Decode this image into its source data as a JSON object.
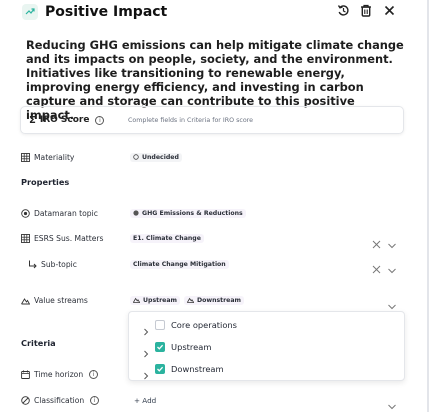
{
  "header": {
    "title": "Positive Impact",
    "icons": [
      "trend-icon",
      "history-icon",
      "trash-icon",
      "close-icon"
    ]
  },
  "description": "Reducing GHG emissions can help mitigate climate change and its impacts on people, society, and the environment. Initiatives like transitioning to renewable energy, improving energy efficiency, and investing in carbon capture and storage can contribute to this positive impact.",
  "iro": {
    "sigma": "Σ",
    "label": "IRO Score",
    "hint": "Complete fields in Criteria for IRO score"
  },
  "materiality": {
    "label": "Materiality",
    "value": "Undecided"
  },
  "properties": {
    "title": "Properties",
    "datamaran_topic": {
      "label": "Datamaran topic",
      "value": "GHG Emissions & Reductions"
    },
    "esrs_matters": {
      "label": "ESRS Sus. Matters",
      "value": "E1. Climate Change"
    },
    "sub_topic": {
      "label": "Sub-topic",
      "value": "Climate Change Mitigation"
    },
    "value_streams": {
      "label": "Value streams",
      "chips": [
        "Upstream",
        "Downstream"
      ]
    }
  },
  "dropdown": {
    "options": [
      {
        "label": "Core operations",
        "checked": false
      },
      {
        "label": "Upstream",
        "checked": true
      },
      {
        "label": "Downstream",
        "checked": true
      }
    ]
  },
  "criteria": {
    "title": "Criteria",
    "time_horizon": {
      "label": "Time horizon"
    },
    "classification": {
      "label": "Classification",
      "add": "+ Add"
    }
  },
  "colors": {
    "accent": "#2bb39f",
    "chip_bg": "#f6f3fa",
    "border": "#e4e6ea"
  }
}
